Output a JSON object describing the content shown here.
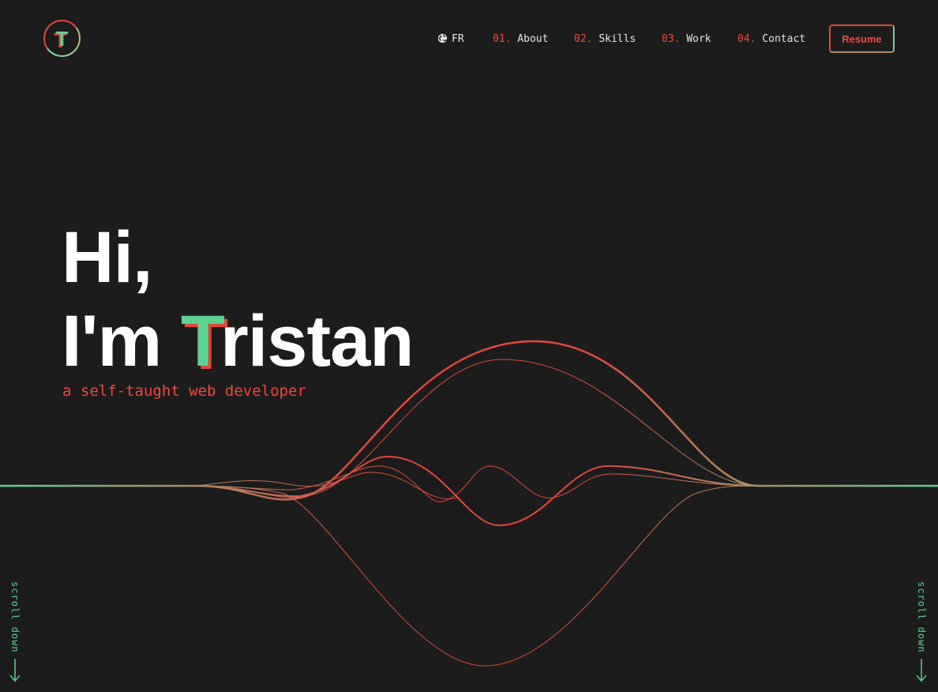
{
  "logo": {
    "letter": "T"
  },
  "nav": {
    "language": "FR",
    "items": [
      {
        "num": "01.",
        "label": "About"
      },
      {
        "num": "02.",
        "label": "Skills"
      },
      {
        "num": "03.",
        "label": "Work"
      },
      {
        "num": "04.",
        "label": "Contact"
      }
    ],
    "resume_label": "Resume"
  },
  "hero": {
    "line1": "Hi,",
    "line2_prefix": "I'm ",
    "name_initial": "T",
    "name_rest": "ristan",
    "subtitle": "a self-taught web developer"
  },
  "scroll": {
    "left_label": "scroll down",
    "right_label": "scroll down"
  },
  "colors": {
    "background": "#1c1c1c",
    "accent_red": "#f04a3d",
    "accent_green": "#5ed191",
    "text": "#e6e6e6"
  },
  "icons": {
    "language": "globe-icon",
    "scroll": "arrow-down-icon"
  }
}
